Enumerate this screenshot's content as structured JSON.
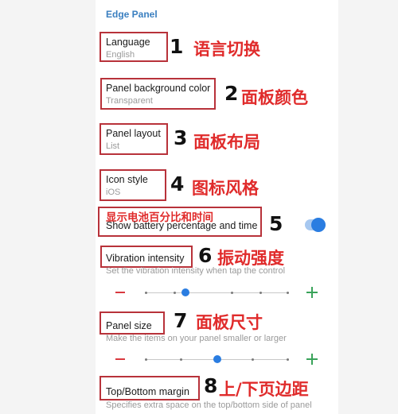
{
  "header": {
    "title": "Edge Panel"
  },
  "items": [
    {
      "title": "Language",
      "value": "English",
      "num": "1",
      "note": "语言切换"
    },
    {
      "title": "Panel background color",
      "value": "Transparent",
      "num": "2",
      "note": "面板颜色"
    },
    {
      "title": "Panel layout",
      "value": "List",
      "num": "3",
      "note": "面板布局"
    },
    {
      "title": "Icon style",
      "value": "iOS",
      "num": "4",
      "note": "图标风格"
    },
    {
      "title": "Show battery percentage and time",
      "num": "5",
      "note": "显示电池百分比和时间",
      "toggle_on": true
    },
    {
      "title": "Vibration intensity",
      "desc": "Set the vibration intensity when tap the control",
      "num": "6",
      "note": "振动强度",
      "level": 0.28
    },
    {
      "title": "Panel size",
      "desc": "Make the items on your panel smaller or larger",
      "num": "7",
      "note": "面板尺寸",
      "level": 0.5
    },
    {
      "title": "Top/Bottom margin",
      "desc": "Specifies extra space on the top/bottom side of panel",
      "num": "8",
      "note": "上/下页边距"
    }
  ],
  "colors": {
    "accent": "#2a7de1",
    "annotation": "#e02b2b",
    "box": "#b8323a",
    "minus": "#d9393f",
    "plus": "#3aa35a"
  },
  "icons": {
    "decrease": "minus-icon",
    "increase": "plus-icon"
  }
}
